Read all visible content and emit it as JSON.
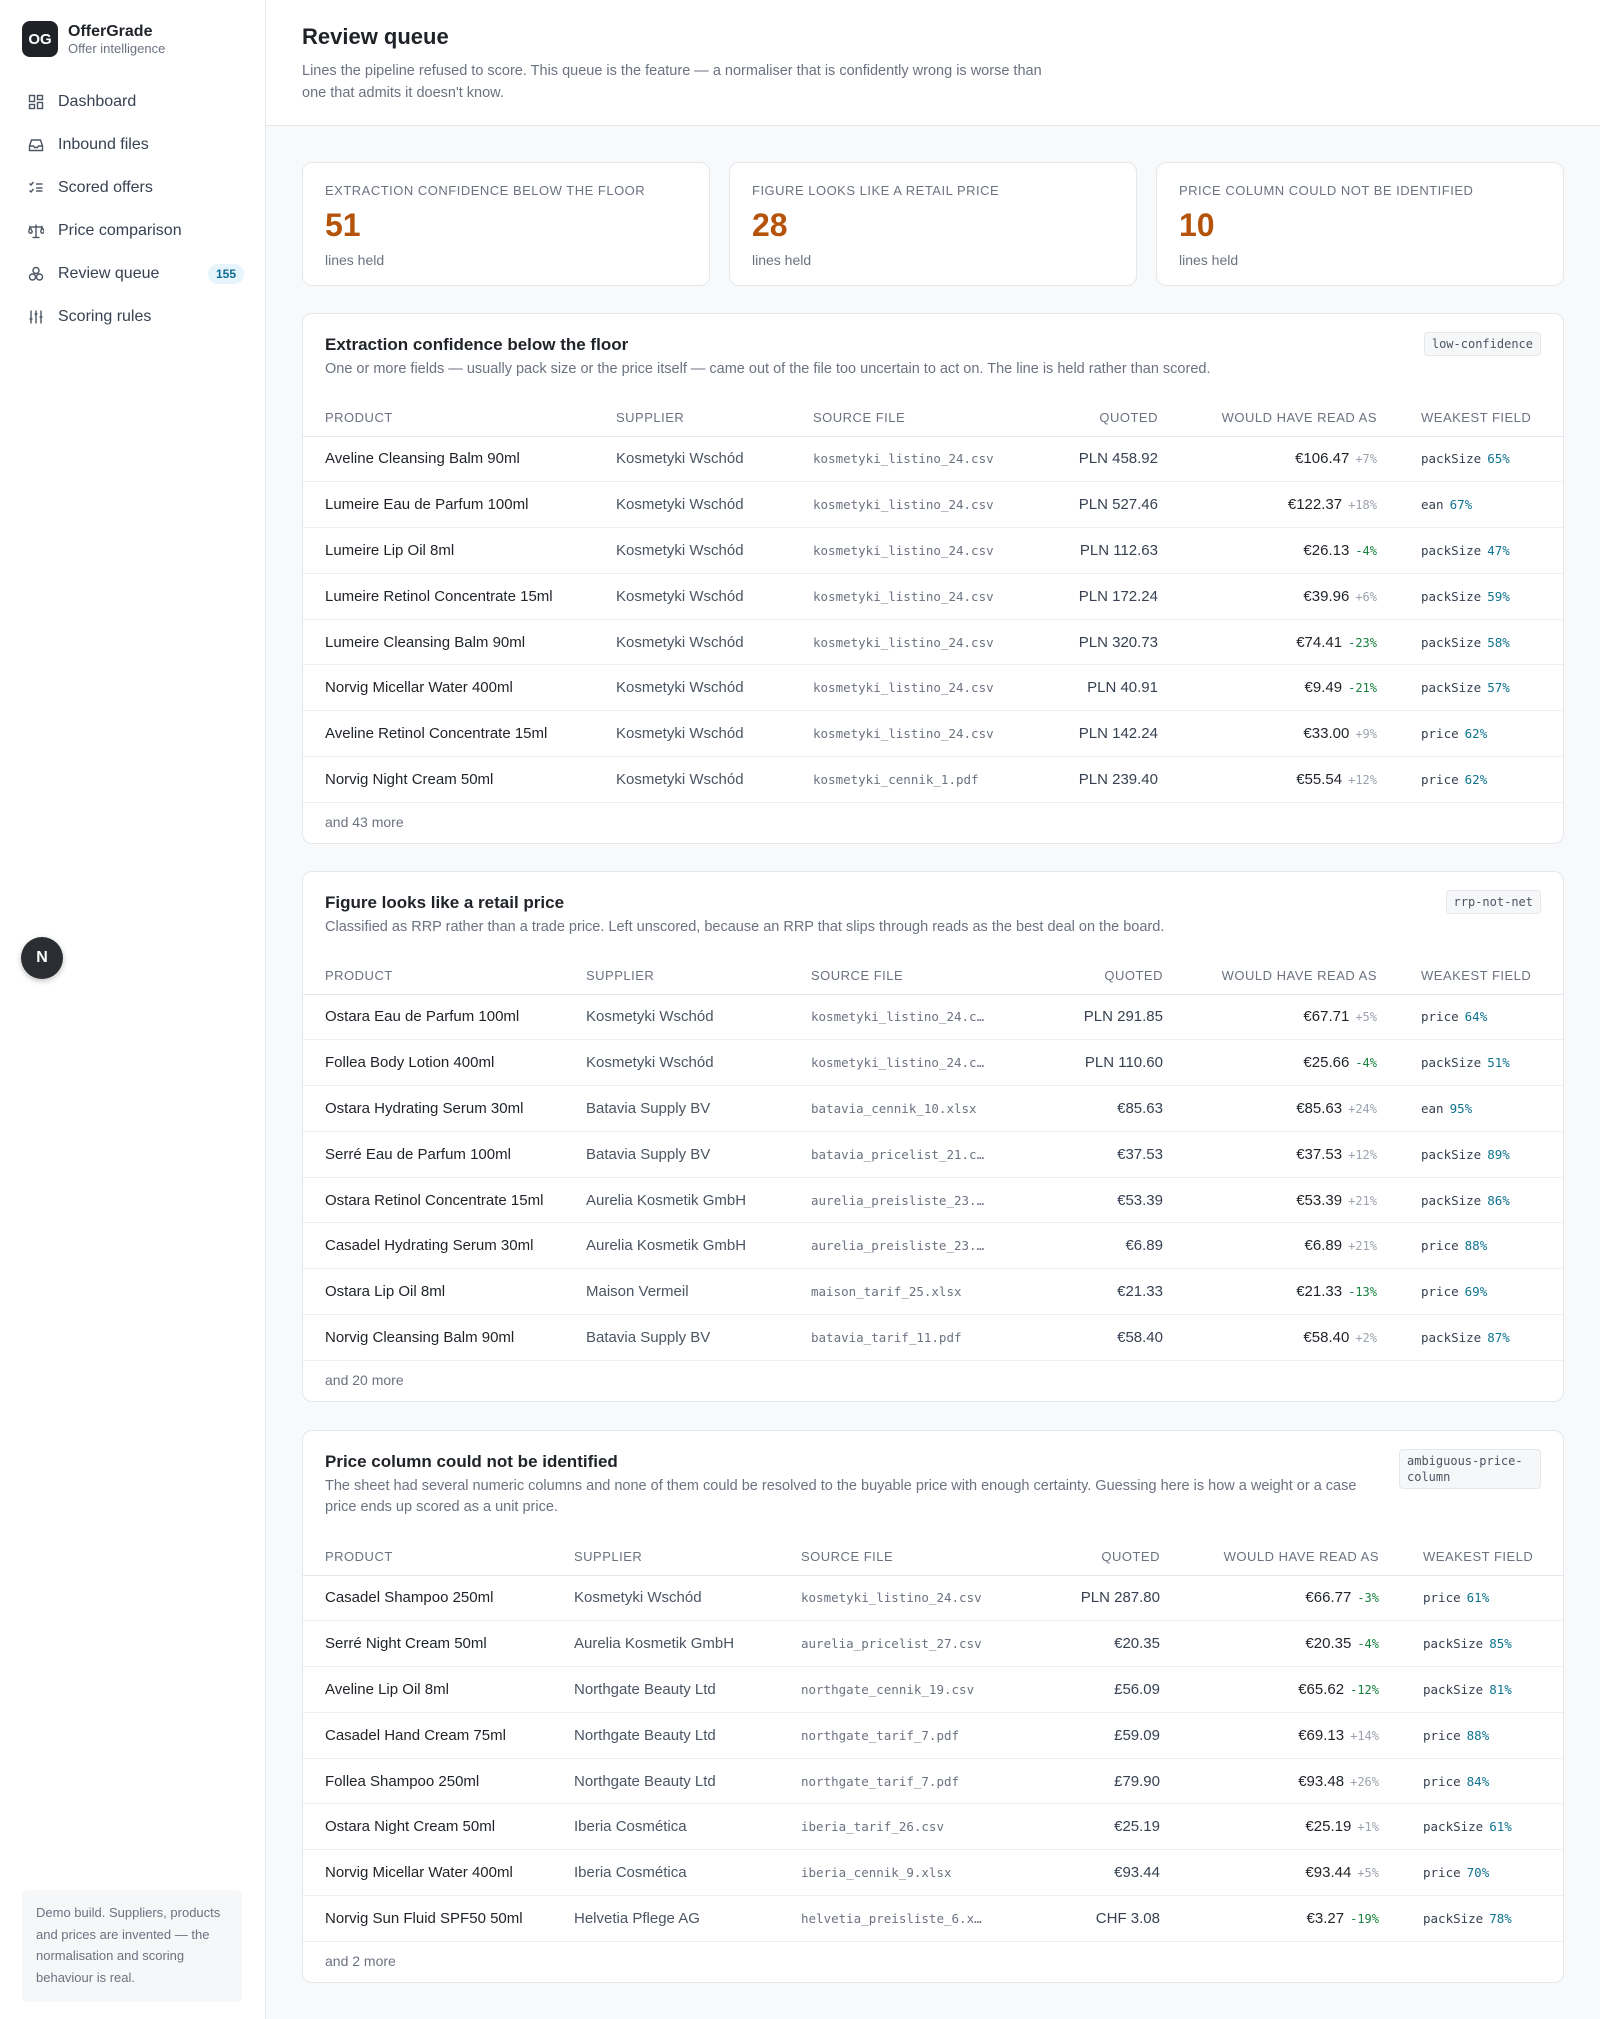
{
  "brand": {
    "logo": "OG",
    "name": "OfferGrade",
    "tagline": "Offer intelligence"
  },
  "sidebar": {
    "items": [
      {
        "label": "Dashboard",
        "icon": "dashboard-icon"
      },
      {
        "label": "Inbound files",
        "icon": "inbox-icon"
      },
      {
        "label": "Scored offers",
        "icon": "checklist-icon"
      },
      {
        "label": "Price comparison",
        "icon": "scale-icon"
      },
      {
        "label": "Review queue",
        "icon": "review-icon",
        "badge": "155"
      },
      {
        "label": "Scoring rules",
        "icon": "sliders-icon"
      }
    ],
    "note": "Demo build. Suppliers, products and prices are invented — the normalisation and scoring behaviour is real.",
    "fab": "N"
  },
  "page": {
    "title": "Review queue",
    "subtitle": "Lines the pipeline refused to score. This queue is the feature — a normaliser that is confidently wrong is worse than one that admits it doesn't know."
  },
  "stats": [
    {
      "label": "Extraction confidence below the floor",
      "value": "51",
      "sub": "lines held"
    },
    {
      "label": "Figure looks like a retail price",
      "value": "28",
      "sub": "lines held"
    },
    {
      "label": "Price column could not be identified",
      "value": "10",
      "sub": "lines held"
    }
  ],
  "columns": [
    "Product",
    "Supplier",
    "Source file",
    "Quoted",
    "Would have read as",
    "Weakest field"
  ],
  "sections": [
    {
      "title": "Extraction confidence below the floor",
      "desc": "One or more fields — usually pack size or the price itself — came out of the file too uncertain to act on. The line is held rather than scored.",
      "tag": "low-confidence",
      "more": "and 43 more",
      "rows": [
        {
          "product": "Aveline Cleansing Balm 90ml",
          "supplier": "Kosmetyki Wschód",
          "file": "kosmetyki_listino_24.csv",
          "quoted": "PLN 458.92",
          "read": "€106.47",
          "delta": "+7%",
          "field": "packSize",
          "pct": "65%"
        },
        {
          "product": "Lumeire Eau de Parfum 100ml",
          "supplier": "Kosmetyki Wschód",
          "file": "kosmetyki_listino_24.csv",
          "quoted": "PLN 527.46",
          "read": "€122.37",
          "delta": "+18%",
          "field": "ean",
          "pct": "67%"
        },
        {
          "product": "Lumeire Lip Oil 8ml",
          "supplier": "Kosmetyki Wschód",
          "file": "kosmetyki_listino_24.csv",
          "quoted": "PLN 112.63",
          "read": "€26.13",
          "delta": "-4%",
          "field": "packSize",
          "pct": "47%"
        },
        {
          "product": "Lumeire Retinol Concentrate 15ml",
          "supplier": "Kosmetyki Wschód",
          "file": "kosmetyki_listino_24.csv",
          "quoted": "PLN 172.24",
          "read": "€39.96",
          "delta": "+6%",
          "field": "packSize",
          "pct": "59%"
        },
        {
          "product": "Lumeire Cleansing Balm 90ml",
          "supplier": "Kosmetyki Wschód",
          "file": "kosmetyki_listino_24.csv",
          "quoted": "PLN 320.73",
          "read": "€74.41",
          "delta": "-23%",
          "field": "packSize",
          "pct": "58%"
        },
        {
          "product": "Norvig Micellar Water 400ml",
          "supplier": "Kosmetyki Wschód",
          "file": "kosmetyki_listino_24.csv",
          "quoted": "PLN 40.91",
          "read": "€9.49",
          "delta": "-21%",
          "field": "packSize",
          "pct": "57%"
        },
        {
          "product": "Aveline Retinol Concentrate 15ml",
          "supplier": "Kosmetyki Wschód",
          "file": "kosmetyki_listino_24.csv",
          "quoted": "PLN 142.24",
          "read": "€33.00",
          "delta": "+9%",
          "field": "price",
          "pct": "62%"
        },
        {
          "product": "Norvig Night Cream 50ml",
          "supplier": "Kosmetyki Wschód",
          "file": "kosmetyki_cennik_1.pdf",
          "quoted": "PLN 239.40",
          "read": "€55.54",
          "delta": "+12%",
          "field": "price",
          "pct": "62%"
        }
      ]
    },
    {
      "title": "Figure looks like a retail price",
      "desc": "Classified as RRP rather than a trade price. Left unscored, because an RRP that slips through reads as the best deal on the board.",
      "tag": "rrp-not-net",
      "more": "and 20 more",
      "rows": [
        {
          "product": "Ostara Eau de Parfum 100ml",
          "supplier": "Kosmetyki Wschód",
          "file": "kosmetyki_listino_24.c…",
          "quoted": "PLN 291.85",
          "read": "€67.71",
          "delta": "+5%",
          "field": "price",
          "pct": "64%"
        },
        {
          "product": "Follea Body Lotion 400ml",
          "supplier": "Kosmetyki Wschód",
          "file": "kosmetyki_listino_24.c…",
          "quoted": "PLN 110.60",
          "read": "€25.66",
          "delta": "-4%",
          "field": "packSize",
          "pct": "51%"
        },
        {
          "product": "Ostara Hydrating Serum 30ml",
          "supplier": "Batavia Supply BV",
          "file": "batavia_cennik_10.xlsx",
          "quoted": "€85.63",
          "read": "€85.63",
          "delta": "+24%",
          "field": "ean",
          "pct": "95%"
        },
        {
          "product": "Serré Eau de Parfum 100ml",
          "supplier": "Batavia Supply BV",
          "file": "batavia_pricelist_21.c…",
          "quoted": "€37.53",
          "read": "€37.53",
          "delta": "+12%",
          "field": "packSize",
          "pct": "89%"
        },
        {
          "product": "Ostara Retinol Concentrate 15ml",
          "supplier": "Aurelia Kosmetik GmbH",
          "file": "aurelia_preisliste_23.…",
          "quoted": "€53.39",
          "read": "€53.39",
          "delta": "+21%",
          "field": "packSize",
          "pct": "86%"
        },
        {
          "product": "Casadel Hydrating Serum 30ml",
          "supplier": "Aurelia Kosmetik GmbH",
          "file": "aurelia_preisliste_23.…",
          "quoted": "€6.89",
          "read": "€6.89",
          "delta": "+21%",
          "field": "price",
          "pct": "88%"
        },
        {
          "product": "Ostara Lip Oil 8ml",
          "supplier": "Maison Vermeil",
          "file": "maison_tarif_25.xlsx",
          "quoted": "€21.33",
          "read": "€21.33",
          "delta": "-13%",
          "field": "price",
          "pct": "69%"
        },
        {
          "product": "Norvig Cleansing Balm 90ml",
          "supplier": "Batavia Supply BV",
          "file": "batavia_tarif_11.pdf",
          "quoted": "€58.40",
          "read": "€58.40",
          "delta": "+2%",
          "field": "packSize",
          "pct": "87%"
        }
      ]
    },
    {
      "title": "Price column could not be identified",
      "desc": "The sheet had several numeric columns and none of them could be resolved to the buyable price with enough certainty. Guessing here is how a weight or a case price ends up scored as a unit price.",
      "tag": "ambiguous-price-column",
      "more": "and 2 more",
      "rows": [
        {
          "product": "Casadel Shampoo 250ml",
          "supplier": "Kosmetyki Wschód",
          "file": "kosmetyki_listino_24.csv",
          "quoted": "PLN 287.80",
          "read": "€66.77",
          "delta": "-3%",
          "field": "price",
          "pct": "61%"
        },
        {
          "product": "Serré Night Cream 50ml",
          "supplier": "Aurelia Kosmetik GmbH",
          "file": "aurelia_pricelist_27.csv",
          "quoted": "€20.35",
          "read": "€20.35",
          "delta": "-4%",
          "field": "packSize",
          "pct": "85%"
        },
        {
          "product": "Aveline Lip Oil 8ml",
          "supplier": "Northgate Beauty Ltd",
          "file": "northgate_cennik_19.csv",
          "quoted": "£56.09",
          "read": "€65.62",
          "delta": "-12%",
          "field": "packSize",
          "pct": "81%"
        },
        {
          "product": "Casadel Hand Cream 75ml",
          "supplier": "Northgate Beauty Ltd",
          "file": "northgate_tarif_7.pdf",
          "quoted": "£59.09",
          "read": "€69.13",
          "delta": "+14%",
          "field": "price",
          "pct": "88%"
        },
        {
          "product": "Follea Shampoo 250ml",
          "supplier": "Northgate Beauty Ltd",
          "file": "northgate_tarif_7.pdf",
          "quoted": "£79.90",
          "read": "€93.48",
          "delta": "+26%",
          "field": "price",
          "pct": "84%"
        },
        {
          "product": "Ostara Night Cream 50ml",
          "supplier": "Iberia Cosmética",
          "file": "iberia_tarif_26.csv",
          "quoted": "€25.19",
          "read": "€25.19",
          "delta": "+1%",
          "field": "packSize",
          "pct": "61%"
        },
        {
          "product": "Norvig Micellar Water 400ml",
          "supplier": "Iberia Cosmética",
          "file": "iberia_cennik_9.xlsx",
          "quoted": "€93.44",
          "read": "€93.44",
          "delta": "+5%",
          "field": "price",
          "pct": "70%"
        },
        {
          "product": "Norvig Sun Fluid SPF50 50ml",
          "supplier": "Helvetia Pflege AG",
          "file": "helvetia_preisliste_6.x…",
          "quoted": "CHF 3.08",
          "read": "€3.27",
          "delta": "-19%",
          "field": "packSize",
          "pct": "78%"
        }
      ]
    }
  ],
  "colors": {
    "accent": "#b45309",
    "positive": "#15803d",
    "badge": "#0e6b94",
    "percent": "#0e7490"
  }
}
